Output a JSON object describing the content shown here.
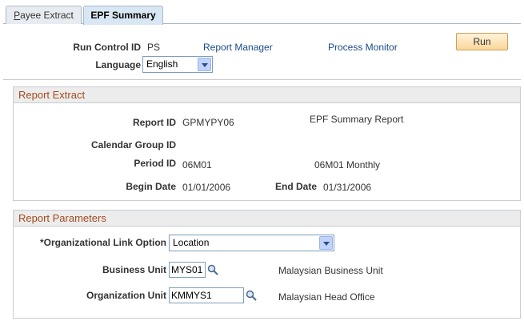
{
  "tabs": [
    {
      "label_first": "P",
      "label_rest": "ayee Extract"
    },
    {
      "label": "EPF Summary"
    }
  ],
  "run_control": {
    "label": "Run Control ID",
    "value": "PS",
    "report_manager": "Report Manager",
    "process_monitor": "Process Monitor",
    "run_button": "Run"
  },
  "language": {
    "label": "Language",
    "value": "English"
  },
  "report_extract": {
    "title": "Report Extract",
    "report_id_label": "Report ID",
    "report_id_value": "GPMYPY06",
    "report_desc": "EPF Summary Report",
    "calendar_group_label": "Calendar Group ID",
    "period_id_label": "Period ID",
    "period_id_value": "06M01",
    "period_desc": "06M01 Monthly",
    "begin_date_label": "Begin Date",
    "begin_date_value": "01/01/2006",
    "end_date_label": "End Date",
    "end_date_value": "01/31/2006"
  },
  "report_parameters": {
    "title": "Report Parameters",
    "org_link_label": "*Organizational Link Option",
    "org_link_value": "Location",
    "business_unit_label": "Business Unit",
    "business_unit_value": "MYS01",
    "business_unit_desc": "Malaysian Business Unit",
    "org_unit_label": "Organization Unit",
    "org_unit_value": "KMMYS1",
    "org_unit_desc": "Malaysian Head Office"
  },
  "icons": {
    "lookup": "magnifier-icon",
    "dropdown": "chevron-down-icon"
  },
  "colors": {
    "group_title": "#a34a1f",
    "link": "#1a4a8a",
    "run_button": "#f9d79a"
  }
}
